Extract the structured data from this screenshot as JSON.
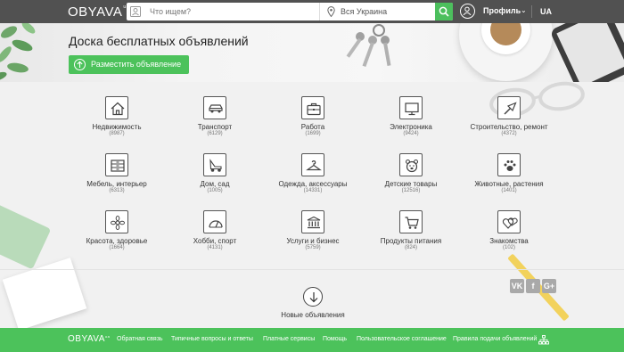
{
  "header": {
    "logo": "OBYAVA",
    "logo_suffix": "ua",
    "search_placeholder": "Что ищем?",
    "region_label": "Вся Украина",
    "profile_label": "Профиль",
    "lang": "UA"
  },
  "hero": {
    "title": "Доска бесплатных объявлений",
    "post_button_label": "Разместить объявление"
  },
  "categories": [
    {
      "label": "Недвижимость",
      "count": "(8987)",
      "icon": "house-icon"
    },
    {
      "label": "Транспорт",
      "count": "(6129)",
      "icon": "car-icon"
    },
    {
      "label": "Работа",
      "count": "(1699)",
      "icon": "briefcase-icon"
    },
    {
      "label": "Электроника",
      "count": "(9424)",
      "icon": "monitor-icon"
    },
    {
      "label": "Строительство, ремонт",
      "count": "(4372)",
      "icon": "trowel-icon"
    },
    {
      "label": "Мебель, интерьер",
      "count": "(6313)",
      "icon": "dresser-icon"
    },
    {
      "label": "Дом, сад",
      "count": "(1005)",
      "icon": "lawnmower-icon"
    },
    {
      "label": "Одежда, аксессуары",
      "count": "(14331)",
      "icon": "hanger-icon"
    },
    {
      "label": "Детские товары",
      "count": "(12516)",
      "icon": "teddy-bear-icon"
    },
    {
      "label": "Животные, растения",
      "count": "(1401)",
      "icon": "paw-icon"
    },
    {
      "label": "Красота, здоровье",
      "count": "(1664)",
      "icon": "flower-icon"
    },
    {
      "label": "Хобби, спорт",
      "count": "(4131)",
      "icon": "gauge-icon"
    },
    {
      "label": "Услуги и бизнес",
      "count": "(5759)",
      "icon": "bank-icon"
    },
    {
      "label": "Продукты питания",
      "count": "(824)",
      "icon": "cart-icon"
    },
    {
      "label": "Знакомства",
      "count": "(102)",
      "icon": "hearts-icon"
    }
  ],
  "new_ads": {
    "label": "Новые объявления"
  },
  "social": [
    "VK",
    "f",
    "G+"
  ],
  "footer": {
    "logo": "OBYAVA",
    "logo_suffix": "ua",
    "links": [
      "Обратная связь",
      "Типичные вопросы и ответы",
      "Платные сервисы",
      "Помощь",
      "Пользовательское соглашение",
      "Правила подачи объявлений"
    ]
  },
  "colors": {
    "accent": "#4cc25b",
    "header_bg": "#515151"
  }
}
